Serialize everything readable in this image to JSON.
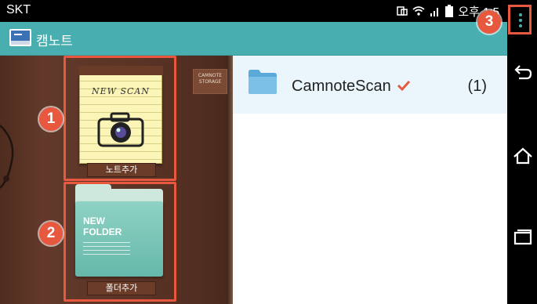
{
  "status_bar": {
    "carrier": "SKT",
    "time": "오후 1:5"
  },
  "app_bar": {
    "title": "캠노트"
  },
  "notebook": {
    "label_tag": "CAMNOTE STORAGE",
    "tiles": [
      {
        "note_title": "NEW SCAN",
        "caption": "노트추가"
      },
      {
        "folder_title_line1": "NEW",
        "folder_title_line2": "FOLDER",
        "caption": "폴더추가"
      }
    ]
  },
  "folder_list": [
    {
      "name": "CamnoteScan",
      "count": "(1)"
    }
  ],
  "callouts": [
    "1",
    "2",
    "3"
  ],
  "icons": {
    "app_logo": "camnote-logo-icon",
    "folder": "folder-icon",
    "check": "check-icon",
    "overflow": "more-vert-icon",
    "back": "back-icon",
    "home": "home-icon",
    "recents": "recents-icon"
  },
  "colors": {
    "app_bar": "#48aeb0",
    "callout": "#e8583e",
    "selected_row": "#eaf6fb"
  }
}
